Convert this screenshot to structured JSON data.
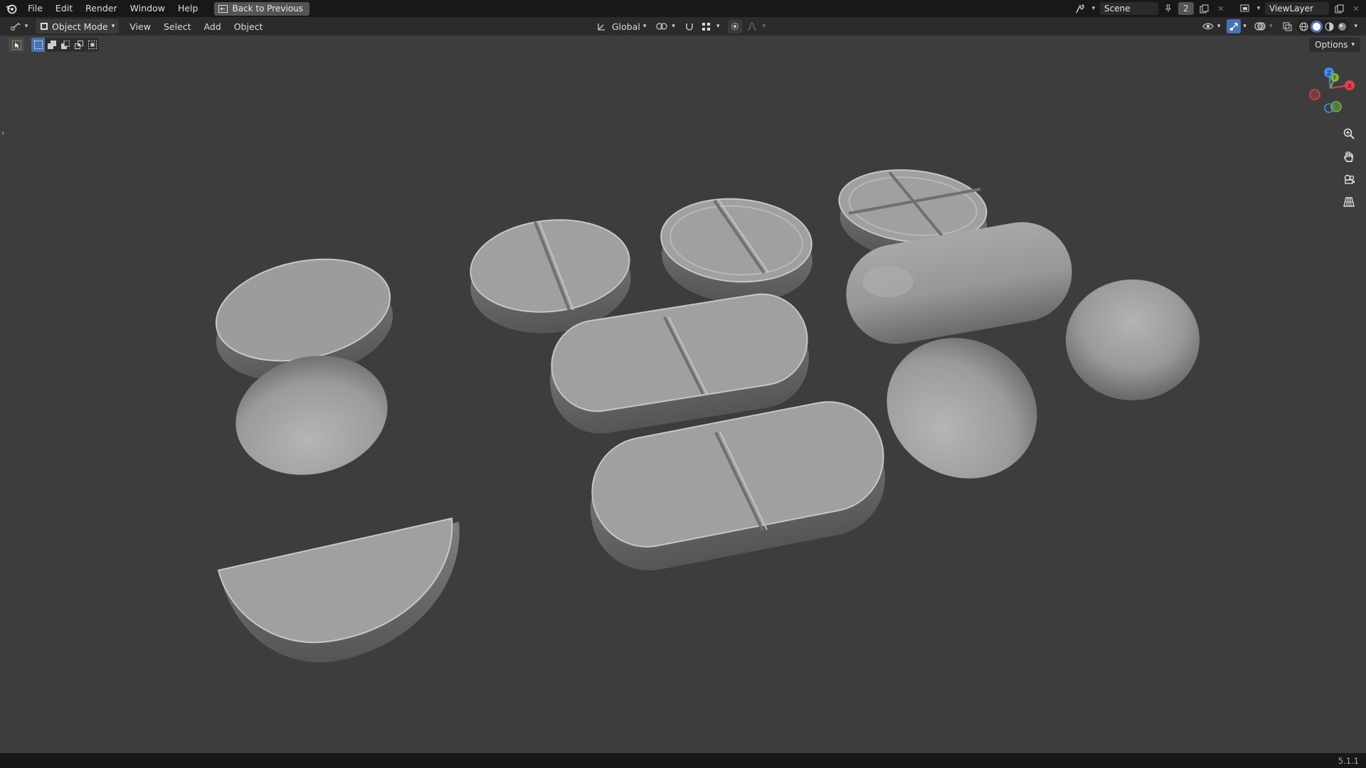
{
  "topbar": {
    "menus": [
      "File",
      "Edit",
      "Render",
      "Window",
      "Help"
    ],
    "back_button": "Back to Previous",
    "scene": {
      "label": "Scene",
      "count": "2"
    },
    "view_layer": "ViewLayer"
  },
  "header": {
    "mode": "Object Mode",
    "menus": [
      "View",
      "Select",
      "Add",
      "Object"
    ],
    "transform_orientation": "Global"
  },
  "toolbar": {
    "options_label": "Options"
  },
  "gizmo": {
    "x": "X",
    "y": "Y",
    "z": "Z"
  },
  "statusbar": {
    "version": "5.1.1"
  },
  "colors": {
    "accent": "#4772b3",
    "background": "#3d3d3d",
    "axis_x": "#e0414f",
    "axis_y": "#7ab53b",
    "axis_z": "#3d8ef2"
  }
}
